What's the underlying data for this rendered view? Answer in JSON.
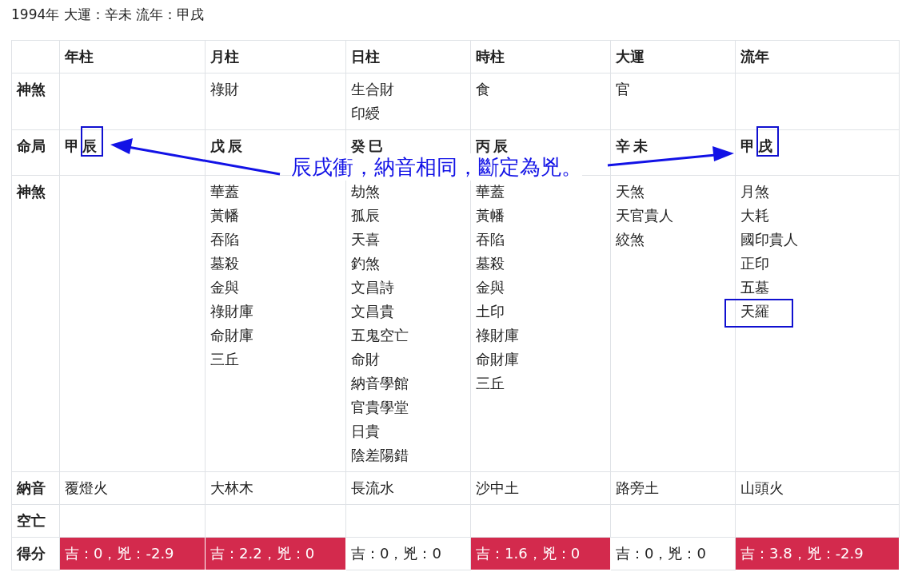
{
  "heading": "1994年 大運：辛未 流年：甲戌",
  "columns": [
    "年柱",
    "月柱",
    "日柱",
    "時柱",
    "大運",
    "流年"
  ],
  "rows": [
    {
      "kind": "list",
      "label": "神煞",
      "cells": [
        [],
        [
          {
            "text": "祿財",
            "marked": false
          }
        ],
        [
          {
            "text": "生合財",
            "marked": false
          },
          {
            "text": "印綬",
            "marked": false
          }
        ],
        [
          {
            "text": "食",
            "marked": false
          }
        ],
        [
          {
            "text": "官",
            "marked": false
          }
        ],
        []
      ]
    },
    {
      "kind": "pillar",
      "label": "命局",
      "cells": [
        {
          "text": "甲辰",
          "marked": true
        },
        {
          "text": "戊辰",
          "marked": false
        },
        {
          "text": "癸巳",
          "marked": false
        },
        {
          "text": "丙辰",
          "marked": false
        },
        {
          "text": "辛未",
          "marked": false
        },
        {
          "text": "甲戌",
          "marked": true
        }
      ]
    },
    {
      "kind": "list",
      "label": "神煞",
      "cells": [
        [],
        [
          {
            "text": "華蓋",
            "marked": false
          },
          {
            "text": "黃幡",
            "marked": false
          },
          {
            "text": "吞陷",
            "marked": false
          },
          {
            "text": "墓殺",
            "marked": false
          },
          {
            "text": "金與",
            "marked": false
          },
          {
            "text": "祿財庫",
            "marked": false
          },
          {
            "text": "命財庫",
            "marked": false
          },
          {
            "text": "三丘",
            "marked": false
          }
        ],
        [
          {
            "text": "劫煞",
            "marked": false
          },
          {
            "text": "孤辰",
            "marked": false
          },
          {
            "text": "天喜",
            "marked": false
          },
          {
            "text": "釣煞",
            "marked": false
          },
          {
            "text": "文昌詩",
            "marked": false
          },
          {
            "text": "文昌貴",
            "marked": false
          },
          {
            "text": "五鬼空亡",
            "marked": false
          },
          {
            "text": "命財",
            "marked": false
          },
          {
            "text": "納音學館",
            "marked": false
          },
          {
            "text": "官貴學堂",
            "marked": false
          },
          {
            "text": "日貴",
            "marked": false
          },
          {
            "text": "陰差陽錯",
            "marked": false
          }
        ],
        [
          {
            "text": "華蓋",
            "marked": false
          },
          {
            "text": "黃幡",
            "marked": false
          },
          {
            "text": "吞陷",
            "marked": false
          },
          {
            "text": "墓殺",
            "marked": false
          },
          {
            "text": "金與",
            "marked": false
          },
          {
            "text": "土印",
            "marked": false
          },
          {
            "text": "祿財庫",
            "marked": false
          },
          {
            "text": "命財庫",
            "marked": false
          },
          {
            "text": "三丘",
            "marked": false
          }
        ],
        [
          {
            "text": "天煞",
            "marked": false
          },
          {
            "text": "天官貴人",
            "marked": false
          },
          {
            "text": "絞煞",
            "marked": false
          }
        ],
        [
          {
            "text": "月煞",
            "marked": false
          },
          {
            "text": "大耗",
            "marked": false
          },
          {
            "text": "國印貴人",
            "marked": false
          },
          {
            "text": "正印",
            "marked": false
          },
          {
            "text": "五墓",
            "marked": false
          },
          {
            "text": "天羅",
            "marked": true
          }
        ]
      ]
    },
    {
      "kind": "plain",
      "label": "納音",
      "cells": [
        {
          "text": "覆燈火",
          "highlighted": false
        },
        {
          "text": "大林木",
          "highlighted": false
        },
        {
          "text": "長流水",
          "highlighted": false
        },
        {
          "text": "沙中土",
          "highlighted": false
        },
        {
          "text": "路旁土",
          "highlighted": false
        },
        {
          "text": "山頭火",
          "highlighted": false
        }
      ]
    },
    {
      "kind": "plain",
      "label": "空亡",
      "cells": []
    },
    {
      "kind": "plain",
      "label": "得分",
      "cells": [
        {
          "text": "吉：0，兇：-2.9",
          "highlighted": true
        },
        {
          "text": "吉：2.2，兇：0",
          "highlighted": true
        },
        {
          "text": "吉：0，兇：0",
          "highlighted": false
        },
        {
          "text": "吉：1.6，兇：0",
          "highlighted": true
        },
        {
          "text": "吉：0，兇：0",
          "highlighted": false
        },
        {
          "text": "吉：3.8，兇：-2.9",
          "highlighted": true
        }
      ]
    }
  ],
  "annotation": {
    "text": "辰戌衝，納音相同，斷定為兇。"
  }
}
